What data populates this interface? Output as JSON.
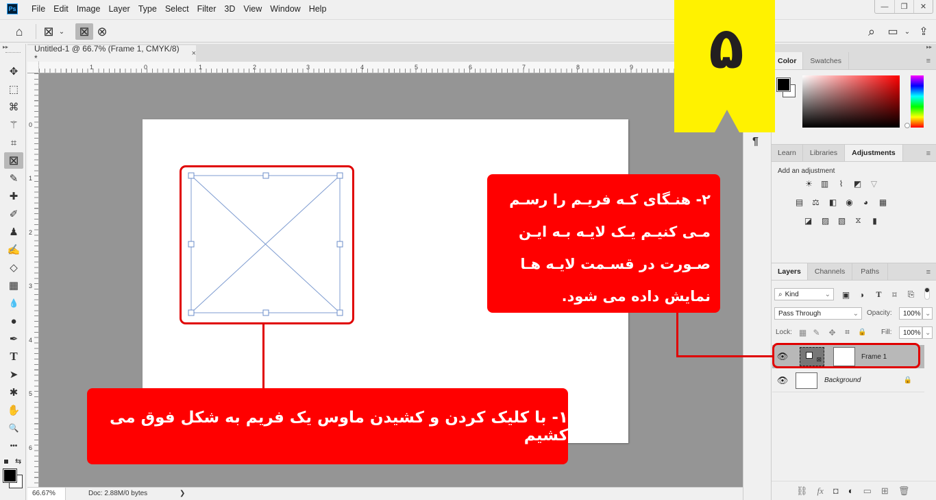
{
  "app": {
    "logo": "Ps"
  },
  "menu": [
    "File",
    "Edit",
    "Image",
    "Layer",
    "Type",
    "Select",
    "Filter",
    "3D",
    "View",
    "Window",
    "Help"
  ],
  "window_controls": {
    "minimize": "—",
    "restore": "❐",
    "close": "✕"
  },
  "options_bar": {
    "home": "⌂",
    "frame_tool": "⊠",
    "dropdown": "⌄",
    "rect_frame": "⊠",
    "ellipse_frame": "⊗",
    "search": "⌕",
    "workspace": "▭",
    "share": "⇪"
  },
  "document_tab": {
    "title": "Untitled-1 @ 66.7% (Frame 1, CMYK/8) *",
    "close": "×"
  },
  "rulers": {
    "horizontal": [
      "1",
      "0",
      "1",
      "2",
      "3",
      "4",
      "5",
      "6",
      "7",
      "8",
      "9"
    ],
    "vertical": [
      "0",
      "1",
      "2",
      "3",
      "4",
      "5",
      "6"
    ]
  },
  "status": {
    "zoom": "66.67%",
    "doc": "Doc: 2.88M/0 bytes",
    "arrow": "❯"
  },
  "tools": [
    {
      "name": "move",
      "glyph": "✥"
    },
    {
      "name": "marquee",
      "glyph": "⬚"
    },
    {
      "name": "lasso",
      "glyph": "⌘"
    },
    {
      "name": "magic-wand",
      "glyph": "⚚"
    },
    {
      "name": "crop",
      "glyph": "⌗"
    },
    {
      "name": "frame",
      "glyph": "⊠",
      "active": true
    },
    {
      "name": "eyedropper",
      "glyph": "✎"
    },
    {
      "name": "healing",
      "glyph": "✚"
    },
    {
      "name": "brush",
      "glyph": "✐"
    },
    {
      "name": "stamp",
      "glyph": "♟"
    },
    {
      "name": "history-brush",
      "glyph": "✍"
    },
    {
      "name": "eraser",
      "glyph": "◇"
    },
    {
      "name": "gradient",
      "glyph": "▦"
    },
    {
      "name": "blur",
      "glyph": "💧"
    },
    {
      "name": "dodge",
      "glyph": "●"
    },
    {
      "name": "pen",
      "glyph": "✒"
    },
    {
      "name": "type",
      "glyph": "T"
    },
    {
      "name": "path-select",
      "glyph": "➤"
    },
    {
      "name": "shape",
      "glyph": "✱"
    },
    {
      "name": "hand",
      "glyph": "✋"
    },
    {
      "name": "zoom",
      "glyph": "🔍"
    },
    {
      "name": "more",
      "glyph": "•••"
    }
  ],
  "narrow_col": {
    "paragraph": "¶"
  },
  "color_panel": {
    "tabs": [
      "Color",
      "Swatches"
    ],
    "active": "Color",
    "menu": "≡",
    "fg": "#000000",
    "bg": "#ffffff",
    "hue": "#ff0000"
  },
  "adjustments_panel": {
    "tabs": [
      "Learn",
      "Libraries",
      "Adjustments"
    ],
    "active": "Adjustments",
    "menu": "≡",
    "subtitle": "Add an adjustment",
    "rows": [
      [
        "☀",
        "▥",
        "⌇",
        "◩",
        "▽"
      ],
      [
        "▤",
        "⚖",
        "◧",
        "◉",
        "◕",
        "▦"
      ],
      [
        "◪",
        "▨",
        "▧",
        "⧖",
        "▮"
      ]
    ]
  },
  "layers_panel": {
    "tabs": [
      "Layers",
      "Channels",
      "Paths"
    ],
    "active": "Layers",
    "menu": "≡",
    "filter": {
      "value": "Kind",
      "icons": [
        "▣",
        "◑",
        "T",
        "⌑",
        "⎘"
      ]
    },
    "blend_mode": "Pass Through",
    "opacity_label": "Opacity:",
    "opacity": "100%",
    "lock_label": "Lock:",
    "fill_label": "Fill:",
    "fill": "100%",
    "lock_icons": [
      "▦",
      "✎",
      "✥",
      "⌗",
      "🔒"
    ],
    "layers": [
      {
        "name": "Frame 1",
        "visible": true,
        "selected": true
      },
      {
        "name": "Background",
        "visible": true,
        "locked": true
      }
    ],
    "footer_icons": [
      "⛓",
      "fx",
      "◘",
      "◐",
      "▭",
      "⊞",
      "🗑"
    ]
  },
  "annotations": {
    "badge": "۵",
    "callout_1": "۱- با کلیک کردن و کشیدن ماوس یک فریم به شکل فوق می کشیم",
    "callout_2_lines": [
      "۲- هنـگای کـه فریـم را رسـم",
      "مـی کنیـم یـک لایـه بـه ایـن",
      "صـورت در قسـمت لایـه هـا",
      "نمایش داده می شود."
    ],
    "color": "#ff0000",
    "badge_color": "#fff200"
  }
}
